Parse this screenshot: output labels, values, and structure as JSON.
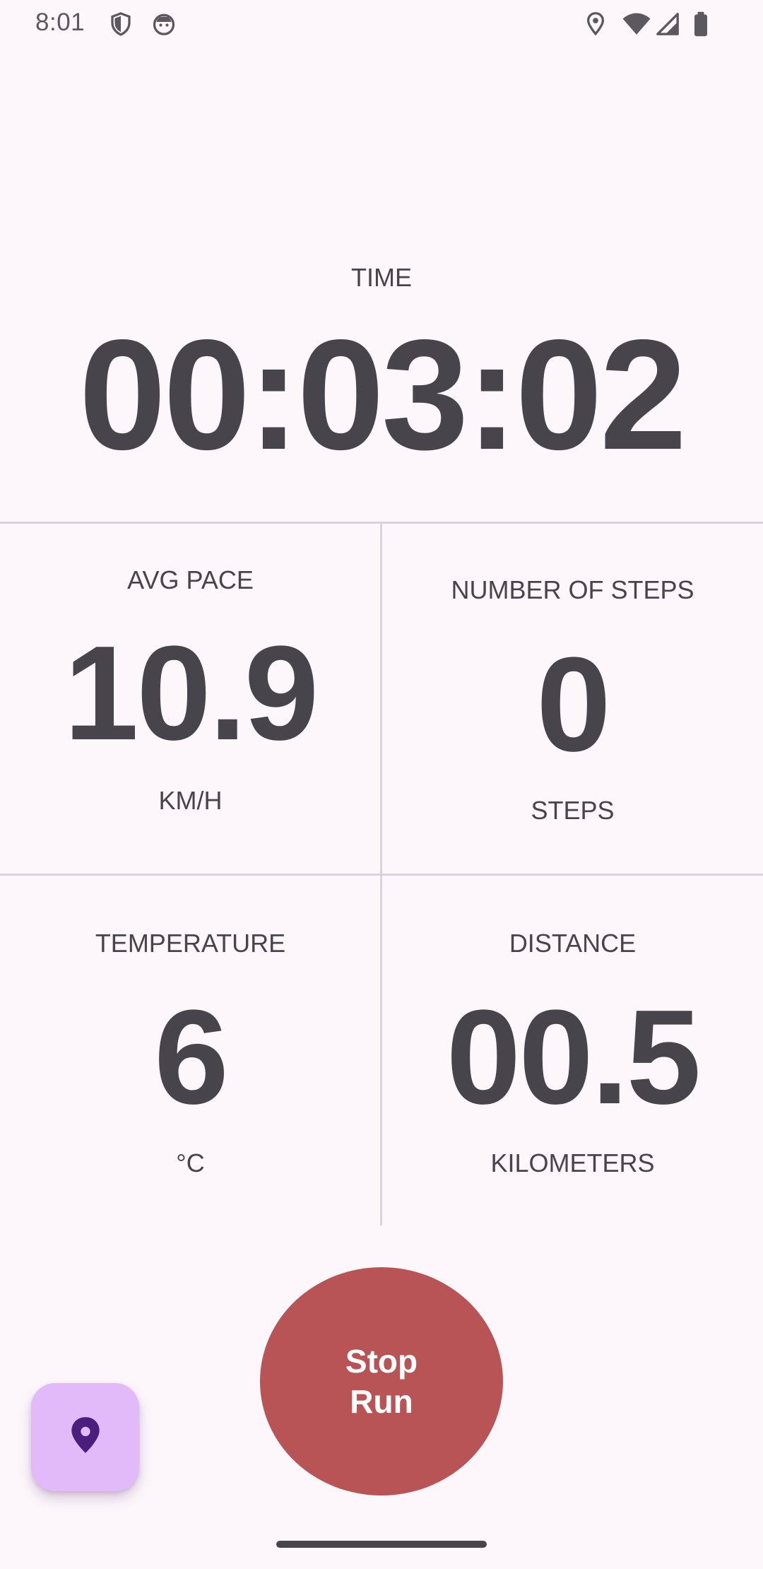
{
  "status_bar": {
    "time": "8:01",
    "left_icons": [
      "shield-icon",
      "android-face-icon"
    ],
    "right_icons": [
      "location-pin-icon",
      "wifi-icon",
      "cell-signal-icon",
      "battery-icon"
    ]
  },
  "time_section": {
    "label": "TIME",
    "value": "00:03:02"
  },
  "stats": {
    "avg_pace": {
      "label": "AVG PACE",
      "value": "10.9",
      "unit": "KM/H"
    },
    "steps": {
      "label": "NUMBER OF STEPS",
      "value": "0",
      "unit": "STEPS"
    },
    "temperature": {
      "label": "TEMPERATURE",
      "value": "6",
      "unit": "°C"
    },
    "distance": {
      "label": "DISTANCE",
      "value": "00.5",
      "unit": "KILOMETERS"
    }
  },
  "stop_button": {
    "label": "Stop Run"
  },
  "fab": {
    "icon": "location-pin-icon"
  },
  "colors": {
    "background": "#fdf7fc",
    "text": "#47444c",
    "stop_button": "#b85456",
    "fab": "#e3baf9",
    "fab_icon": "#4b1d7c",
    "divider": "#d8d4dc"
  }
}
